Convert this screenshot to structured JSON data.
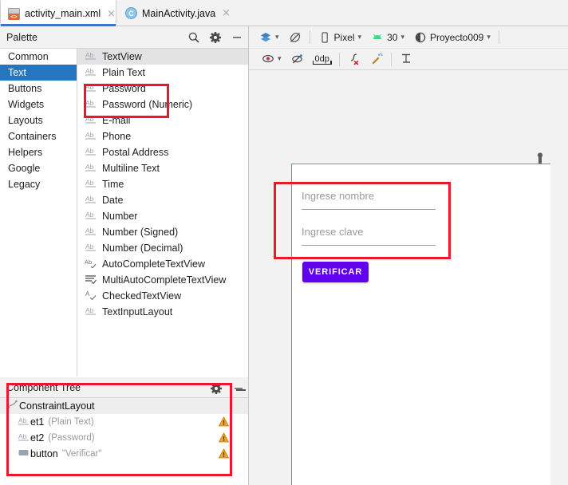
{
  "window": {
    "tabs": [
      {
        "label": "activity_main.xml",
        "icon": "xml-file-icon",
        "active": true,
        "close": "×"
      },
      {
        "label": "MainActivity.java",
        "icon": "java-class-icon",
        "active": false,
        "close": "×"
      }
    ]
  },
  "palette": {
    "title": "Palette",
    "tools": [
      {
        "name": "search-icon",
        "label": "Search"
      },
      {
        "name": "gear-icon",
        "label": "Palette settings"
      },
      {
        "name": "minimize-icon",
        "label": "Hide"
      }
    ],
    "categories": [
      {
        "label": "Common",
        "selected": false
      },
      {
        "label": "Text",
        "selected": true
      },
      {
        "label": "Buttons",
        "selected": false
      },
      {
        "label": "Widgets",
        "selected": false
      },
      {
        "label": "Layouts",
        "selected": false
      },
      {
        "label": "Containers",
        "selected": false
      },
      {
        "label": "Helpers",
        "selected": false
      },
      {
        "label": "Google",
        "selected": false
      },
      {
        "label": "Legacy",
        "selected": false
      }
    ],
    "items": [
      {
        "label": "TextView",
        "icon": "ab-icon",
        "selected": true
      },
      {
        "label": "Plain Text",
        "icon": "ab-icon",
        "selected": false
      },
      {
        "label": "Password",
        "icon": "ab-icon",
        "selected": false
      },
      {
        "label": "Password (Numeric)",
        "icon": "ab-icon",
        "selected": false
      },
      {
        "label": "E-mail",
        "icon": "ab-icon",
        "selected": false
      },
      {
        "label": "Phone",
        "icon": "ab-icon",
        "selected": false
      },
      {
        "label": "Postal Address",
        "icon": "ab-icon",
        "selected": false
      },
      {
        "label": "Multiline Text",
        "icon": "ab-icon",
        "selected": false
      },
      {
        "label": "Time",
        "icon": "ab-icon",
        "selected": false
      },
      {
        "label": "Date",
        "icon": "ab-icon",
        "selected": false
      },
      {
        "label": "Number",
        "icon": "ab-icon",
        "selected": false
      },
      {
        "label": "Number (Signed)",
        "icon": "ab-icon",
        "selected": false
      },
      {
        "label": "Number (Decimal)",
        "icon": "ab-icon",
        "selected": false
      },
      {
        "label": "AutoCompleteTextView",
        "icon": "ab-check-icon",
        "selected": false
      },
      {
        "label": "MultiAutoCompleteTextView",
        "icon": "lines-icon",
        "selected": false
      },
      {
        "label": "CheckedTextView",
        "icon": "a-check-icon",
        "selected": false
      },
      {
        "label": "TextInputLayout",
        "icon": "ab-icon",
        "selected": false
      }
    ]
  },
  "component_tree": {
    "title": "Component Tree",
    "tools": [
      {
        "name": "gear-icon",
        "label": "Settings"
      },
      {
        "name": "minimize-icon",
        "label": "Hide"
      }
    ],
    "rows": [
      {
        "name": "ConstraintLayout",
        "sub": "",
        "icon": "constraint-layout-icon",
        "warning": false,
        "root": true
      },
      {
        "name": "et1",
        "sub": "(Plain Text)",
        "icon": "ab-icon",
        "warning": true,
        "root": false
      },
      {
        "name": "et2",
        "sub": "(Password)",
        "icon": "ab-icon",
        "warning": true,
        "root": false
      },
      {
        "name": "button",
        "sub": "\"Verificar\"",
        "icon": "button-icon",
        "warning": true,
        "root": false
      }
    ],
    "warning_glyph": "⚠"
  },
  "design_toolbar": {
    "row1": [
      {
        "name": "layout-variants-icon",
        "label": "",
        "type": "icon"
      },
      {
        "name": "orientation-icon",
        "label": "",
        "type": "icon"
      },
      {
        "name": "device-selector",
        "label": "Pixel",
        "type": "dropdown",
        "icon": "phone-icon"
      },
      {
        "name": "api-level-selector",
        "label": "30",
        "type": "dropdown",
        "icon": "android-icon"
      },
      {
        "name": "theme-selector",
        "label": "Proyecto009",
        "type": "dropdown",
        "icon": "theme-icon"
      }
    ],
    "row2": [
      {
        "name": "view-options-icon",
        "label": "",
        "type": "icon"
      },
      {
        "name": "toggle-constraints-icon",
        "label": "",
        "type": "icon"
      },
      {
        "name": "default-margin",
        "label": "0dp",
        "type": "value"
      },
      {
        "name": "clear-constraints-icon",
        "label": "",
        "type": "icon"
      },
      {
        "name": "infer-constraints-icon",
        "label": "",
        "type": "icon"
      },
      {
        "name": "guideline-icon",
        "label": "",
        "type": "icon"
      }
    ]
  },
  "preview": {
    "wrench_icon": "wrench-icon",
    "fields": [
      {
        "name": "nombre-field",
        "hint": "Ingrese nombre"
      },
      {
        "name": "clave-field",
        "hint": "Ingrese clave"
      }
    ],
    "button": {
      "label": "VERIFICAR",
      "color": "#6002ee"
    }
  },
  "annotations": {
    "color": "#e8192c",
    "boxes": [
      {
        "name": "palette-text-fields-highlight"
      },
      {
        "name": "preview-edittexts-highlight"
      },
      {
        "name": "component-tree-highlight"
      }
    ]
  }
}
